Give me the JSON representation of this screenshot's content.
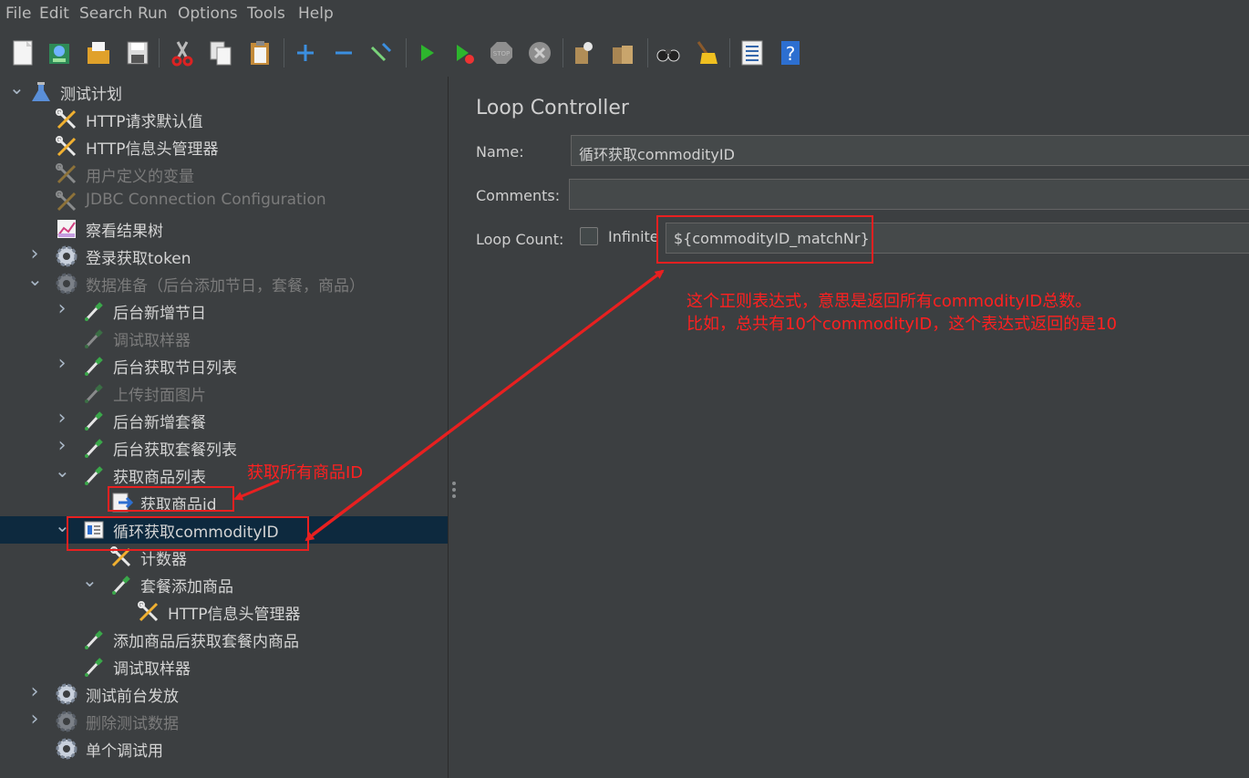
{
  "menu": [
    "File",
    "Edit",
    "Search",
    "Run",
    "Options",
    "Tools",
    "Help"
  ],
  "tree": [
    {
      "label": "测试计划",
      "icon": "flask-icon",
      "arrow": "down",
      "disabled": false
    },
    {
      "label": "HTTP请求默认值",
      "icon": "wrench-scissors-icon",
      "arrow": "",
      "disabled": false
    },
    {
      "label": "HTTP信息头管理器",
      "icon": "wrench-scissors-icon",
      "arrow": "",
      "disabled": false
    },
    {
      "label": "用户定义的变量",
      "icon": "wrench-scissors-icon",
      "arrow": "",
      "disabled": true
    },
    {
      "label": "JDBC Connection Configuration",
      "icon": "wrench-scissors-icon",
      "arrow": "",
      "disabled": true
    },
    {
      "label": "察看结果树",
      "icon": "graph-icon",
      "arrow": "",
      "disabled": false
    },
    {
      "label": "登录获取token",
      "icon": "gear-icon",
      "arrow": "right",
      "disabled": false
    },
    {
      "label": "数据准备（后台添加节日，套餐，商品）",
      "icon": "gear-icon",
      "arrow": "down",
      "disabled": true
    },
    {
      "label": "后台新增节日",
      "icon": "pipette-icon",
      "arrow": "right",
      "disabled": false
    },
    {
      "label": "调试取样器",
      "icon": "pipette-icon",
      "arrow": "",
      "disabled": true
    },
    {
      "label": "后台获取节日列表",
      "icon": "pipette-icon",
      "arrow": "right",
      "disabled": false
    },
    {
      "label": "上传封面图片",
      "icon": "pipette-icon",
      "arrow": "",
      "disabled": true
    },
    {
      "label": "后台新增套餐",
      "icon": "pipette-icon",
      "arrow": "right",
      "disabled": false
    },
    {
      "label": "后台获取套餐列表",
      "icon": "pipette-icon",
      "arrow": "right",
      "disabled": false
    },
    {
      "label": "获取商品列表",
      "icon": "pipette-icon",
      "arrow": "down",
      "disabled": false
    },
    {
      "label": "获取商品id",
      "icon": "extractor-icon",
      "arrow": "",
      "disabled": false
    },
    {
      "label": "循环获取commodityID",
      "icon": "loop-controller-icon",
      "arrow": "down",
      "disabled": false,
      "selected": true
    },
    {
      "label": "计数器",
      "icon": "wrench-scissors-icon",
      "arrow": "",
      "disabled": false
    },
    {
      "label": "套餐添加商品",
      "icon": "pipette-icon",
      "arrow": "down",
      "disabled": false
    },
    {
      "label": "HTTP信息头管理器",
      "icon": "wrench-scissors-icon",
      "arrow": "",
      "disabled": false
    },
    {
      "label": "添加商品后获取套餐内商品",
      "icon": "pipette-icon",
      "arrow": "",
      "disabled": false
    },
    {
      "label": "调试取样器",
      "icon": "pipette-icon",
      "arrow": "",
      "disabled": false
    },
    {
      "label": "测试前台发放",
      "icon": "gear-icon",
      "arrow": "right",
      "disabled": false
    },
    {
      "label": "删除测试数据",
      "icon": "gear-icon",
      "arrow": "right",
      "disabled": true
    },
    {
      "label": "单个调试用",
      "icon": "gear-icon",
      "arrow": "",
      "disabled": false
    }
  ],
  "panel": {
    "title": "Loop Controller",
    "name_label": "Name:",
    "name_value": "循环获取commodityID",
    "comments_label": "Comments:",
    "comments_value": "",
    "loop_label": "Loop Count:",
    "infinite_label": "Infinite",
    "infinite_checked": false,
    "loop_value": "${commodityID_matchNr}"
  },
  "annotations": {
    "note1": "获取所有商品ID",
    "note2_line1": "这个正则表达式，意思是返回所有commodityID总数。",
    "note2_line2": "比如，总共有10个commodityID，这个表达式返回的是10"
  },
  "colors": {
    "annotation": "#ff2020",
    "selection": "#0d293e",
    "background": "#3c3f41"
  }
}
